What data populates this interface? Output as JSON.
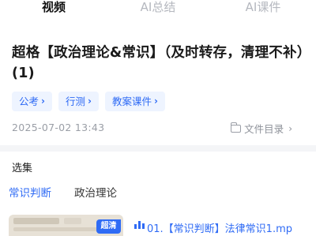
{
  "tabs": [
    {
      "label": "视频",
      "active": true
    },
    {
      "label": "AI总结",
      "active": false
    },
    {
      "label": "AI课件",
      "active": false
    }
  ],
  "course": {
    "title": "超格【政治理论&常识】（及时转存，清理不补）(1)",
    "tags": [
      "公考",
      "行测",
      "教案课件"
    ],
    "date": "2025-07-02 13:43",
    "catalog_label": "文件目录"
  },
  "episodes_section": {
    "label": "选集",
    "categories": [
      {
        "label": "常识判断",
        "active": true
      },
      {
        "label": "政治理论",
        "active": false
      }
    ],
    "items": [
      {
        "badge": "超清",
        "title": "01.【常识判断】法律常识1.mp"
      }
    ]
  },
  "colors": {
    "accent": "#2f6bf5",
    "tag_bg": "#eef4ff",
    "muted": "#9a9ea6",
    "separator": "#f4f5f7"
  },
  "icons": [
    "chevron-right-icon",
    "folder-icon",
    "playing-bars-icon"
  ]
}
